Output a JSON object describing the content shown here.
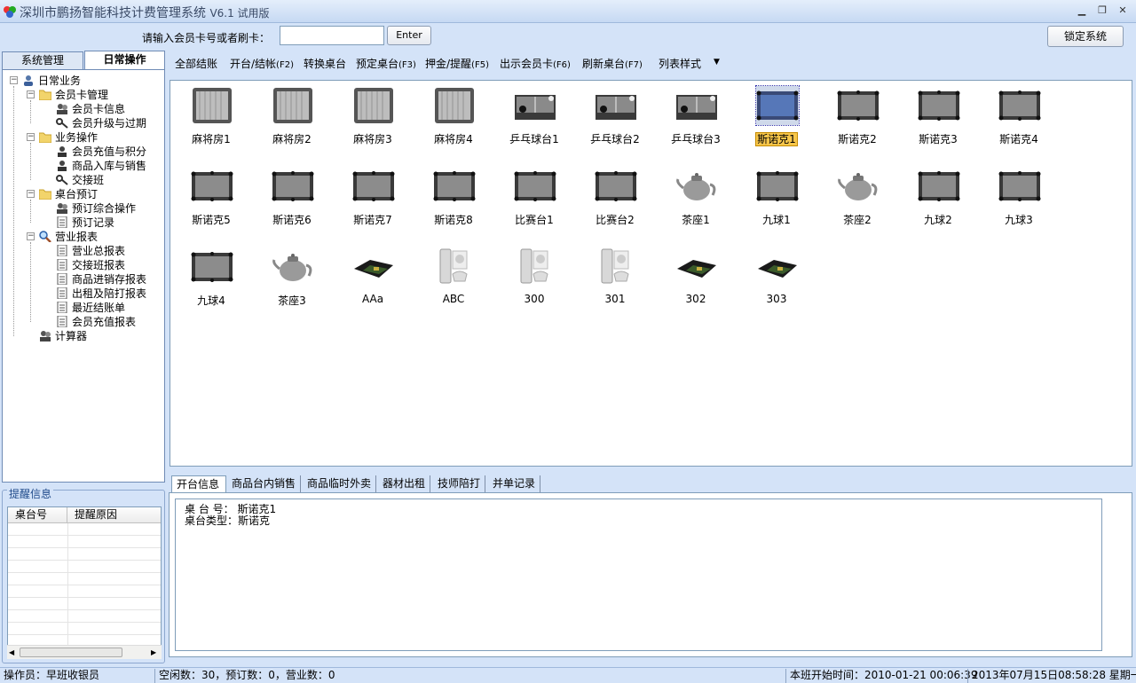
{
  "window": {
    "title": "深圳市鹏扬智能科技计费管理系统",
    "version": "V6.1 试用版"
  },
  "topbar": {
    "card_label": "请输入会员卡号或者刷卡：",
    "card_value": "",
    "enter_label": "Enter",
    "lock_label": "锁定系统"
  },
  "left_tabs": [
    "系统管理",
    "日常操作"
  ],
  "tree": {
    "root": "日常业务",
    "groups": [
      {
        "label": "会员卡管理",
        "items": [
          "会员卡信息",
          "会员升级与过期"
        ]
      },
      {
        "label": "业务操作",
        "items": [
          "会员充值与积分",
          "商品入库与销售",
          "交接班"
        ]
      },
      {
        "label": "桌台预订",
        "items": [
          "预订综合操作",
          "预订记录"
        ]
      },
      {
        "label": "营业报表",
        "items": [
          "营业总报表",
          "交接班报表",
          "商品进销存报表",
          "出租及陪打报表",
          "最近结账单",
          "会员充值报表"
        ]
      }
    ],
    "calculator": "计算器"
  },
  "reminder": {
    "title": "提醒信息",
    "columns": [
      "桌台号",
      "提醒原因"
    ],
    "rows": []
  },
  "toolbar": {
    "items": [
      {
        "label": "全部结账",
        "key": ""
      },
      {
        "label": "开台/结帐",
        "key": "(F2)"
      },
      {
        "label": "转换桌台",
        "key": ""
      },
      {
        "label": "预定桌台",
        "key": "(F3)"
      },
      {
        "label": "押金/提醒",
        "key": "(F5)"
      },
      {
        "label": "出示会员卡",
        "key": "(F6)"
      },
      {
        "label": "刷新桌台",
        "key": "(F7)"
      },
      {
        "label": "列表样式",
        "key": ""
      }
    ]
  },
  "tables": [
    {
      "label": "麻将房1",
      "icon": "mahjong-table"
    },
    {
      "label": "麻将房2",
      "icon": "mahjong-table"
    },
    {
      "label": "麻将房3",
      "icon": "mahjong-table"
    },
    {
      "label": "麻将房4",
      "icon": "mahjong-table"
    },
    {
      "label": "乒乓球台1",
      "icon": "pingpong-table"
    },
    {
      "label": "乒乓球台2",
      "icon": "pingpong-table"
    },
    {
      "label": "乒乓球台3",
      "icon": "pingpong-table"
    },
    {
      "label": "斯诺克1",
      "icon": "billiard-table",
      "selected": true
    },
    {
      "label": "斯诺克2",
      "icon": "billiard-table"
    },
    {
      "label": "斯诺克3",
      "icon": "billiard-table"
    },
    {
      "label": "斯诺克4",
      "icon": "billiard-table"
    },
    {
      "label": "斯诺克5",
      "icon": "billiard-table"
    },
    {
      "label": "斯诺克6",
      "icon": "billiard-table"
    },
    {
      "label": "斯诺克7",
      "icon": "billiard-table"
    },
    {
      "label": "斯诺克8",
      "icon": "billiard-table"
    },
    {
      "label": "比赛台1",
      "icon": "billiard-table"
    },
    {
      "label": "比赛台2",
      "icon": "billiard-table"
    },
    {
      "label": "茶座1",
      "icon": "teapot"
    },
    {
      "label": "九球1",
      "icon": "billiard-table"
    },
    {
      "label": "茶座2",
      "icon": "teapot"
    },
    {
      "label": "九球2",
      "icon": "billiard-table"
    },
    {
      "label": "九球3",
      "icon": "billiard-table"
    },
    {
      "label": "九球4",
      "icon": "billiard-table"
    },
    {
      "label": "茶座3",
      "icon": "teapot"
    },
    {
      "label": "AAa",
      "icon": "game-console"
    },
    {
      "label": "ABC",
      "icon": "xbox"
    },
    {
      "label": "300",
      "icon": "xbox"
    },
    {
      "label": "301",
      "icon": "xbox"
    },
    {
      "label": "302",
      "icon": "game-console"
    },
    {
      "label": "303",
      "icon": "game-console"
    }
  ],
  "bottom_tabs": [
    "开台信息",
    "商品台内销售",
    "商品临时外卖",
    "器材出租",
    "技师陪打",
    "并单记录"
  ],
  "info": {
    "line1_label": "桌 台 号：",
    "line1_value": "斯诺克1",
    "line2_label": "桌台类型：",
    "line2_value": "斯诺克"
  },
  "status": {
    "operator": "操作员：早班收银员",
    "counts": "空闲数：30，预订数：0，营业数：0",
    "shift_start": "本班开始时间：2010-01-21 00:06:39",
    "now": "2013年07月15日08:58:28 星期一"
  },
  "colors": {
    "window_bg": "#d4e3f8",
    "selection_highlight": "#f7c64a",
    "border": "#7f9db9"
  }
}
